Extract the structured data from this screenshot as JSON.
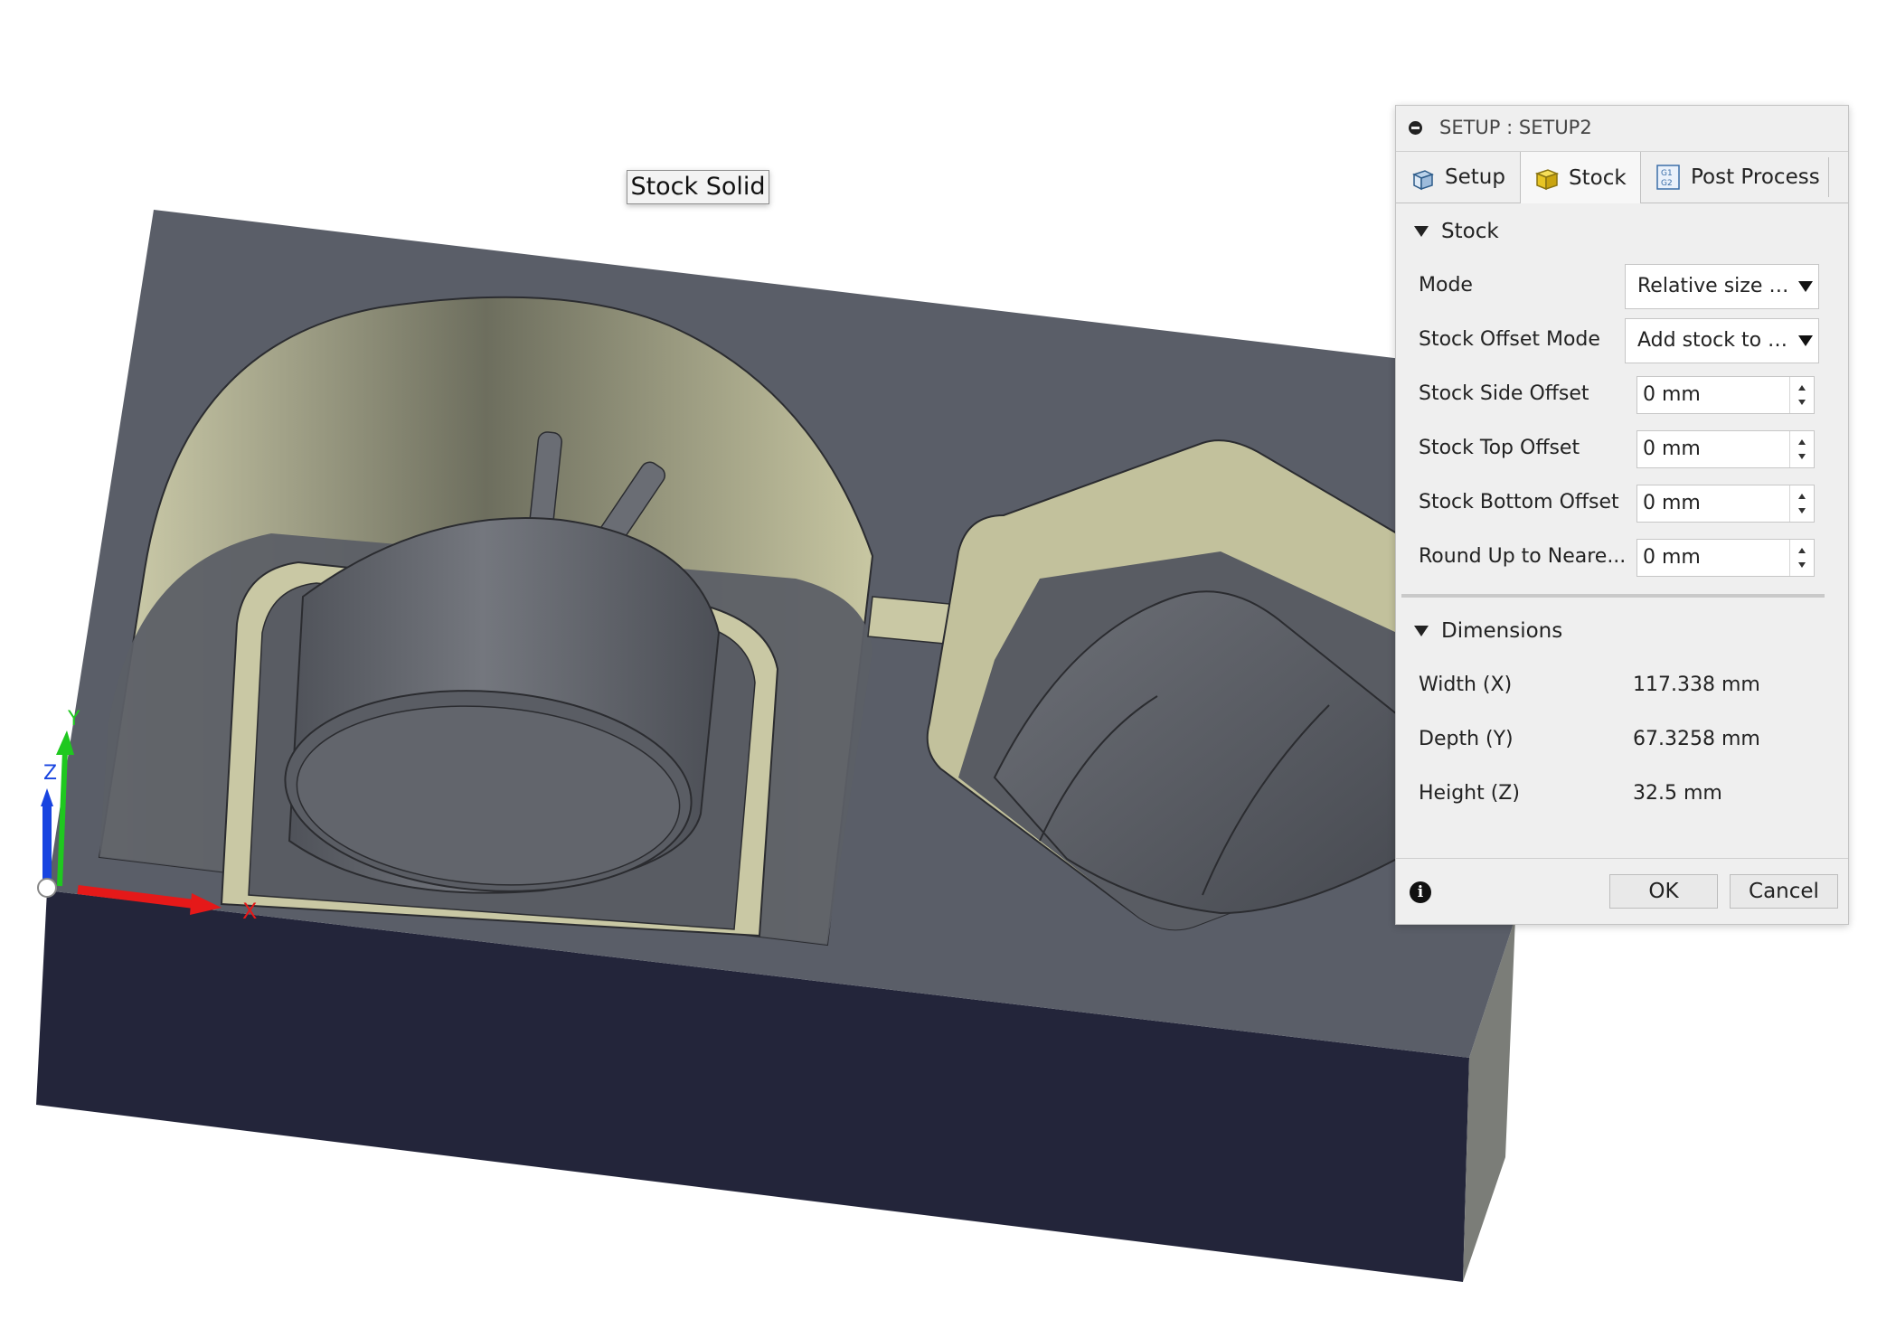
{
  "viewport": {
    "tooltip": "Stock Solid",
    "axis_labels": {
      "x": "X",
      "y": "Y",
      "z": "Z"
    },
    "colors": {
      "stock_top": "#5a5e68",
      "stock_side": "#23253a",
      "pocket_wall": "#c9c8a4",
      "part": "#62656c"
    }
  },
  "dialog": {
    "title": "SETUP : SETUP2",
    "tabs": [
      {
        "label": "Setup",
        "icon": "setup-cube-icon"
      },
      {
        "label": "Stock",
        "icon": "stock-box-icon",
        "active": true
      },
      {
        "label": "Post Process",
        "icon": "g1g2-code-icon"
      }
    ],
    "stock_section": {
      "title": "Stock",
      "mode_label": "Mode",
      "mode_value": "Relative size b...",
      "offset_mode_label": "Stock Offset Mode",
      "offset_mode_value": "Add stock to s...",
      "side_offset_label": "Stock Side Offset",
      "side_offset_value": "0 mm",
      "top_offset_label": "Stock Top Offset",
      "top_offset_value": "0 mm",
      "bottom_offset_label": "Stock Bottom Offset",
      "bottom_offset_value": "0 mm",
      "round_up_label": "Round Up to Neare...",
      "round_up_value": "0 mm"
    },
    "dimensions_section": {
      "title": "Dimensions",
      "width_label": "Width (X)",
      "width_value": "117.338 mm",
      "depth_label": "Depth (Y)",
      "depth_value": "67.3258 mm",
      "height_label": "Height (Z)",
      "height_value": "32.5 mm"
    },
    "ok_label": "OK",
    "cancel_label": "Cancel"
  }
}
